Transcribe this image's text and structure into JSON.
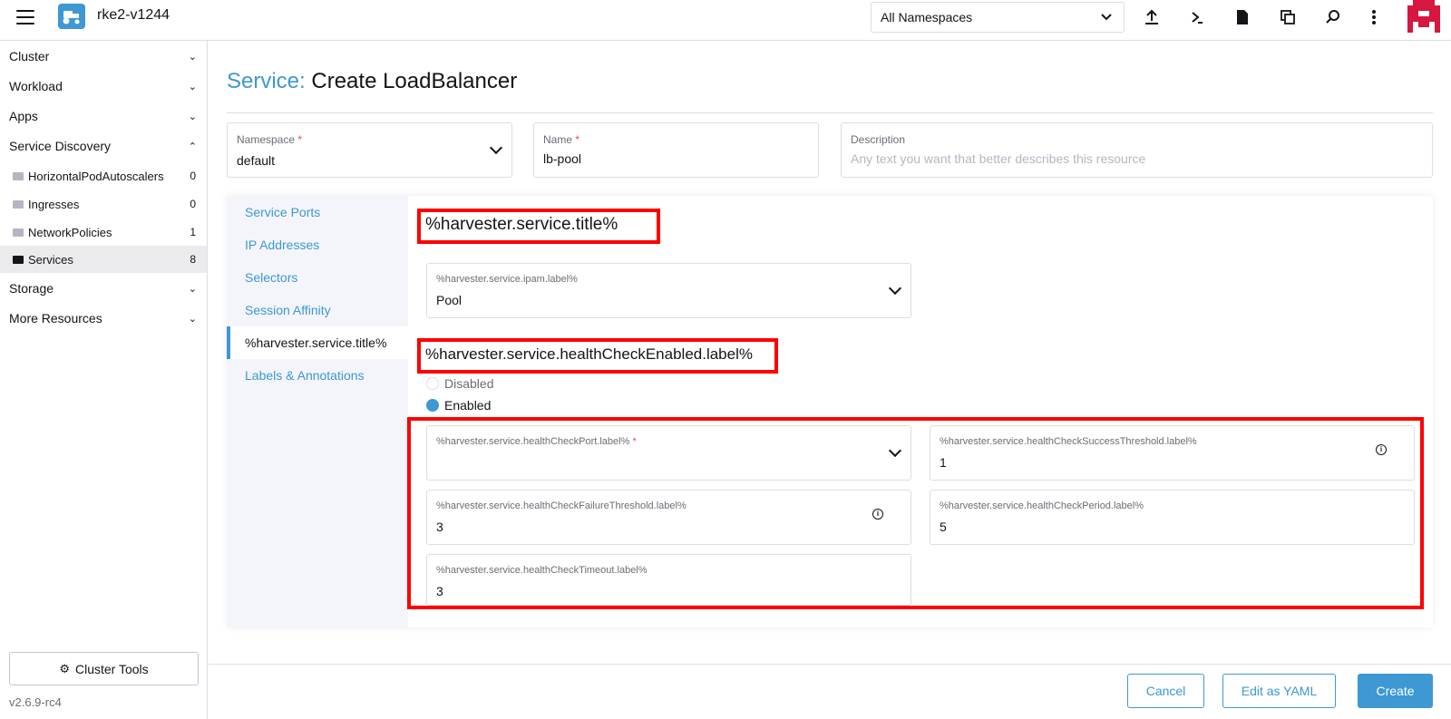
{
  "header": {
    "cluster_name": "rke2-v1244",
    "namespace_filter": "All Namespaces",
    "icons": [
      "upload-icon",
      "terminal-icon",
      "file-icon",
      "copy-config-icon",
      "search-icon",
      "more-vertical-icon"
    ]
  },
  "sidebar": {
    "groups": [
      {
        "label": "Cluster"
      },
      {
        "label": "Workload"
      },
      {
        "label": "Apps"
      },
      {
        "label": "Service Discovery"
      }
    ],
    "service_discovery_items": [
      {
        "label": "HorizontalPodAutoscalers",
        "count": "0"
      },
      {
        "label": "Ingresses",
        "count": "0"
      },
      {
        "label": "NetworkPolicies",
        "count": "1"
      },
      {
        "label": "Services",
        "count": "8"
      }
    ],
    "groups_after": [
      {
        "label": "Storage"
      },
      {
        "label": "More Resources"
      }
    ],
    "cluster_tools": "Cluster Tools",
    "version": "v2.6.9-rc4"
  },
  "page": {
    "title_prefix": "Service:",
    "title": "Create LoadBalancer",
    "namespace": {
      "label": "Namespace",
      "value": "default"
    },
    "name": {
      "label": "Name",
      "value": "lb-pool"
    },
    "description": {
      "label": "Description",
      "placeholder": "Any text you want that better describes this resource"
    },
    "required_mark": "*"
  },
  "tabs": [
    {
      "label": "Service Ports"
    },
    {
      "label": "IP Addresses"
    },
    {
      "label": "Selectors"
    },
    {
      "label": "Session Affinity"
    },
    {
      "label": "%harvester.service.title%"
    },
    {
      "label": "Labels & Annotations"
    }
  ],
  "harvester": {
    "title": "%harvester.service.title%",
    "ipam": {
      "label": "%harvester.service.ipam.label%",
      "value": "Pool"
    },
    "health_check_heading": "%harvester.service.healthCheckEnabled.label%",
    "radio_disabled": "Disabled",
    "radio_enabled": "Enabled",
    "health_check_port": {
      "label": "%harvester.service.healthCheckPort.label%",
      "value": ""
    },
    "success_threshold": {
      "label": "%harvester.service.healthCheckSuccessThreshold.label%",
      "value": "1"
    },
    "failure_threshold": {
      "label": "%harvester.service.healthCheckFailureThreshold.label%",
      "value": "3"
    },
    "period": {
      "label": "%harvester.service.healthCheckPeriod.label%",
      "value": "5"
    },
    "timeout": {
      "label": "%harvester.service.healthCheckTimeout.label%",
      "value": "3"
    }
  },
  "footer": {
    "cancel": "Cancel",
    "edit_yaml": "Edit as YAML",
    "create": "Create"
  },
  "colors": {
    "accent": "#3d98d3",
    "annotation_red": "#ff0000"
  }
}
